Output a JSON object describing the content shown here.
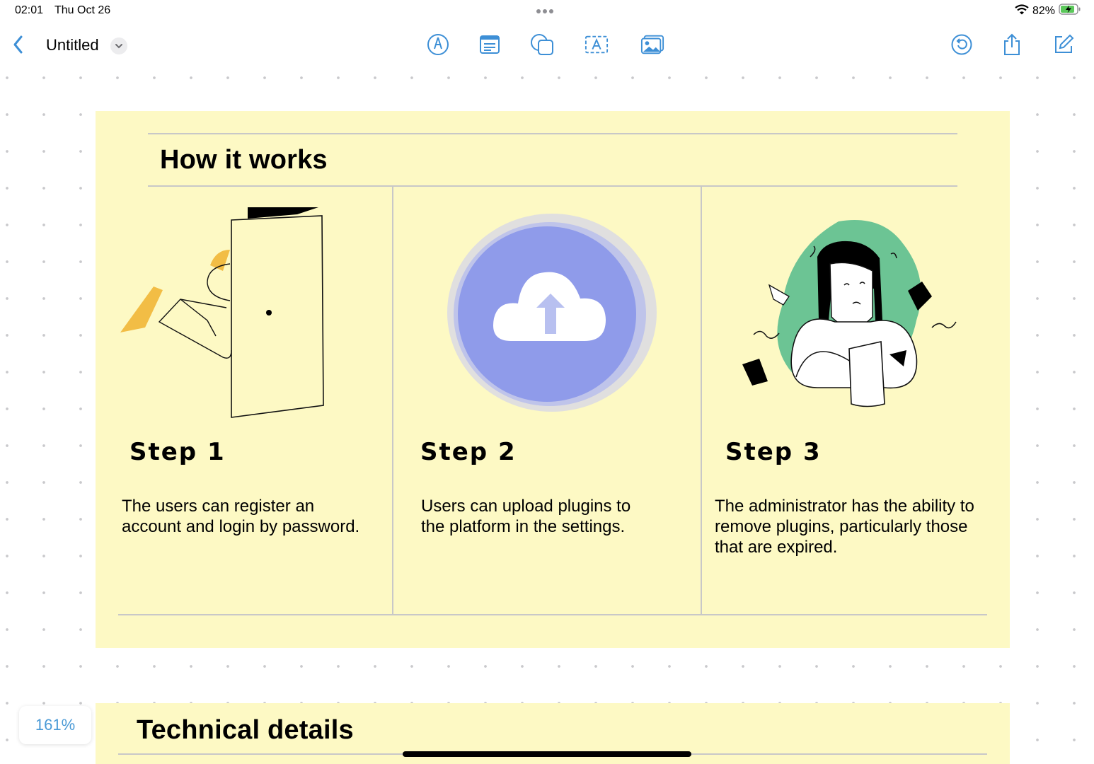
{
  "status": {
    "time": "02:01",
    "date": "Thu Oct 26",
    "battery": "82%"
  },
  "toolbar": {
    "title": "Untitled"
  },
  "card": {
    "heading": "How it works",
    "steps": [
      {
        "title": "Step 1",
        "description": "The users can register an account and login by password."
      },
      {
        "title": "Step 2",
        "description": "Users can upload plugins to the platform in the settings."
      },
      {
        "title": "Step 3",
        "description": "The administrator has the ability to remove plugins, particularly those that are expired."
      }
    ]
  },
  "card2": {
    "heading": "Technical details"
  },
  "zoom": "161%",
  "colors": {
    "accent": "#3d8fd6",
    "sticky": "#fdf9c4",
    "cloud": "#8f9bea",
    "green": "#6cc494",
    "yellow": "#f2bd45"
  }
}
